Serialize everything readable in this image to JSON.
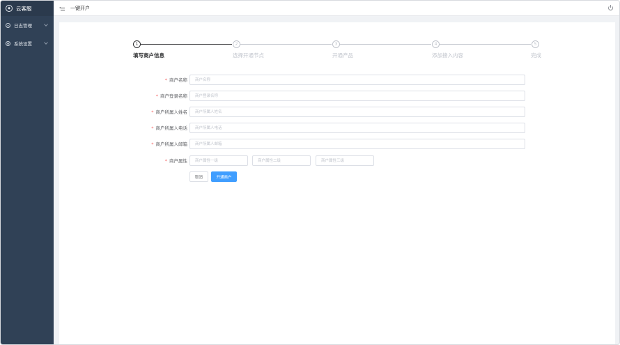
{
  "sidebar": {
    "logo_text": "云客服",
    "items": [
      {
        "label": "日志管理"
      },
      {
        "label": "系统设置"
      }
    ]
  },
  "header": {
    "title": "一键开户"
  },
  "steps": [
    {
      "number": "1",
      "label": "填写商户信息"
    },
    {
      "number": "2",
      "label": "选择开通节点"
    },
    {
      "number": "3",
      "label": "开通产品"
    },
    {
      "number": "4",
      "label": "添加接入内容"
    },
    {
      "number": "5",
      "label": "完成"
    }
  ],
  "form": {
    "merchant_name": {
      "label": "商户名称",
      "placeholder": "商户名称"
    },
    "login_name": {
      "label": "商户登录名称",
      "placeholder": "商户登录名称"
    },
    "owner_name": {
      "label": "商户所属人姓名",
      "placeholder": "商户所属人姓名"
    },
    "owner_phone": {
      "label": "商户所属人电话",
      "placeholder": "商户所属人电话"
    },
    "owner_email": {
      "label": "商户所属人邮箱",
      "placeholder": "商户所属人邮箱"
    },
    "attributes": {
      "label": "商户属性",
      "level1_placeholder": "商户属性一级",
      "level2_placeholder": "商户属性二级",
      "level3_placeholder": "商户属性三级"
    },
    "cancel_label": "取消",
    "submit_label": "开通商户"
  },
  "colors": {
    "sidebar_bg": "#304156",
    "primary": "#409eff",
    "required": "#f56c6c"
  }
}
